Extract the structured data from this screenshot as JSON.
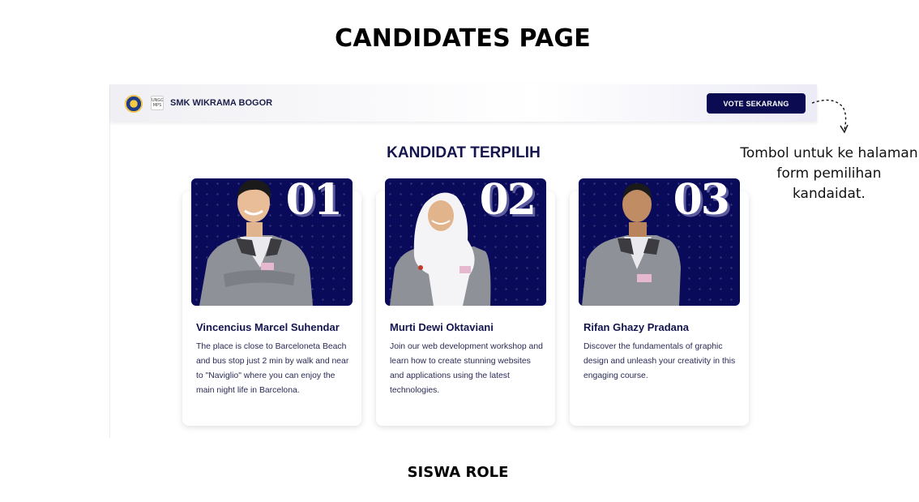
{
  "page_title": "CANDIDATES PAGE",
  "navbar": {
    "school_name": "SMK WIKRAMA BOGOR",
    "logo2_text": "UNGGUL MPS",
    "vote_button": "VOTE SEKARANG"
  },
  "section_title": "KANDIDAT TERPILIH",
  "candidates": [
    {
      "number": "01",
      "name": "Vincencius Marcel Suhendar",
      "description": "The place is close to Barceloneta Beach and bus stop just 2 min by walk and near to \"Naviglio\" where you can enjoy the main night life in Barcelona."
    },
    {
      "number": "02",
      "name": "Murti Dewi Oktaviani",
      "description": "Join our web development workshop and learn how to create stunning websites and applications using the latest technologies."
    },
    {
      "number": "03",
      "name": "Rifan Ghazy Pradana",
      "description": "Discover the fundamentals of graphic design and unleash your creativity in this engaging course."
    }
  ],
  "annotation": "Tombol untuk ke halaman form pemilihan kandaidat.",
  "role_label": "SISWA ROLE",
  "colors": {
    "primary_navy": "#0b0b52",
    "title_navy": "#14144f",
    "photo_bg": "#0a0a5a"
  }
}
